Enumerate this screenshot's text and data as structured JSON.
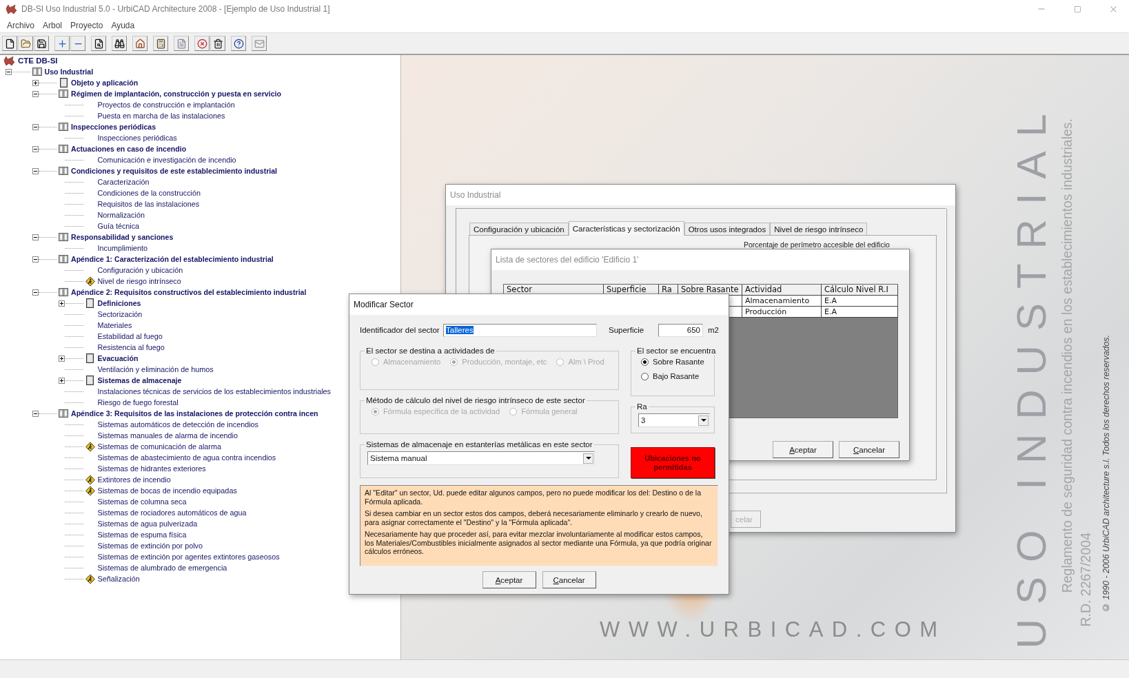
{
  "window": {
    "title": "DB-SI Uso Industrial 5.0 - UrbiCAD Architecture 2008 - [Ejemplo de Uso Industrial 1]"
  },
  "menu": [
    "Archivo",
    "Arbol",
    "Proyecto",
    "Ayuda"
  ],
  "tree": {
    "label": "CTE DB-SI",
    "kind": "root",
    "children": [
      {
        "label": "Uso Industrial",
        "kind": "chapter",
        "expanded": true,
        "children": [
          {
            "label": "Objeto y aplicación",
            "kind": "section",
            "expanded": false
          },
          {
            "label": "Régimen de implantación, construcción y puesta en servicio",
            "kind": "chapter",
            "expanded": true,
            "children": [
              {
                "label": "Proyectos de construcción e implantación",
                "kind": "item"
              },
              {
                "label": "Puesta en marcha de las instalaciones",
                "kind": "item"
              }
            ]
          },
          {
            "label": "Inspecciones periódicas",
            "kind": "chapter",
            "expanded": true,
            "children": [
              {
                "label": "Inspecciones periódicas",
                "kind": "item"
              }
            ]
          },
          {
            "label": "Actuaciones en caso de incendio",
            "kind": "chapter",
            "expanded": true,
            "children": [
              {
                "label": "Comunicación e investigación de incendio",
                "kind": "item"
              }
            ]
          },
          {
            "label": "Condiciones y requisitos de este establecimiento industrial",
            "kind": "chapter",
            "expanded": true,
            "children": [
              {
                "label": "Caracterización",
                "kind": "item"
              },
              {
                "label": "Condiciones de la construcción",
                "kind": "item"
              },
              {
                "label": "Requisitos de las instalaciones",
                "kind": "item"
              },
              {
                "label": "Normalización",
                "kind": "item"
              },
              {
                "label": "Guía técnica",
                "kind": "item"
              }
            ]
          },
          {
            "label": "Responsabilidad y sanciones",
            "kind": "chapter",
            "expanded": true,
            "children": [
              {
                "label": "Incumplimiento",
                "kind": "item"
              }
            ]
          },
          {
            "label": "Apéndice 1: Caracterización del establecimiento industrial",
            "kind": "chapter",
            "expanded": true,
            "children": [
              {
                "label": "Configuración y ubicación",
                "kind": "item"
              },
              {
                "label": "Nivel de riesgo intrínseco",
                "kind": "flagged"
              }
            ]
          },
          {
            "label": "Apéndice 2: Requisitos constructivos del establecimiento industrial",
            "kind": "chapter",
            "expanded": true,
            "children": [
              {
                "label": "Definiciones",
                "kind": "section",
                "expanded": false
              },
              {
                "label": "Sectorización",
                "kind": "item"
              },
              {
                "label": "Materiales",
                "kind": "item"
              },
              {
                "label": "Estabilidad al fuego",
                "kind": "item"
              },
              {
                "label": "Resistencia al fuego",
                "kind": "item"
              },
              {
                "label": "Evacuación",
                "kind": "section",
                "expanded": false
              },
              {
                "label": "Ventilación y eliminación de humos",
                "kind": "item"
              },
              {
                "label": "Sistemas de almacenaje",
                "kind": "section",
                "expanded": false
              },
              {
                "label": "Instalaciones técnicas de servicios de los establecimientos industriales",
                "kind": "item"
              },
              {
                "label": "Riesgo de fuego forestal",
                "kind": "item"
              }
            ]
          },
          {
            "label": "Apéndice 3: Requisitos de las instalaciones de protección contra incen",
            "kind": "chapter",
            "expanded": true,
            "children": [
              {
                "label": "Sistemas automáticos de detección de incendios",
                "kind": "item"
              },
              {
                "label": "Sistemas manuales de alarma de incendio",
                "kind": "item"
              },
              {
                "label": "Sistemas de comunicación de alarma",
                "kind": "flagged"
              },
              {
                "label": "Sistemas de abastecimiento de agua contra incendios",
                "kind": "item"
              },
              {
                "label": "Sistemas de hidrantes exteriores",
                "kind": "item"
              },
              {
                "label": "Extintores de incendio",
                "kind": "flagged"
              },
              {
                "label": "Sistemas de bocas de incendio equipadas",
                "kind": "flagged"
              },
              {
                "label": "Sistemas de columna seca",
                "kind": "item"
              },
              {
                "label": "Sistemas de rociadores automáticos de agua",
                "kind": "item"
              },
              {
                "label": "Sistemas de agua pulverizada",
                "kind": "item"
              },
              {
                "label": "Sistemas de espuma física",
                "kind": "item"
              },
              {
                "label": "Sistemas de extinción por polvo",
                "kind": "item"
              },
              {
                "label": "Sistemas de extinción por agentes extintores gaseosos",
                "kind": "item"
              },
              {
                "label": "Sistemas de alumbrado de emergencia",
                "kind": "item"
              },
              {
                "label": "Señalización",
                "kind": "flagged"
              }
            ]
          }
        ]
      }
    ]
  },
  "splash": {
    "site": "WWW.URBICAD.COM",
    "heading": "USO INDUSTRIAL",
    "subtitle": "Reglamento de seguridad contra incendios en los establecimientos industriales.",
    "decree": "R.D. 2267/2004",
    "copyright": "© 1990 - 2006 UrbiCAD architecture s.l. Todos los derechos reservados."
  },
  "background_window": {
    "title": "Uso Industrial",
    "tabs": [
      {
        "label": "Configuración y ubicación",
        "selected": false
      },
      {
        "label": "Características y sectorización",
        "selected": true
      },
      {
        "label": "Otros usos integrados",
        "selected": false
      },
      {
        "label": "Nivel de riesgo intrínseco",
        "selected": false
      }
    ],
    "partial_label": "Porcentaje de perímetro accesible del edificio",
    "partial_button": "celar"
  },
  "sector_list_window": {
    "title": "Lista de sectores del edificio 'Edificio 1'",
    "columns": [
      "Sector",
      "Superficie",
      "Ra",
      "Sobre Rasante",
      "Actividad",
      "Cálculo Nivel R.I"
    ],
    "rows": [
      {
        "activity": "Almacenamiento",
        "calculation": "E.A"
      },
      {
        "activity": "Producción",
        "calculation": "E.A"
      }
    ],
    "buttons": [
      "Aceptar",
      "Cancelar"
    ]
  },
  "modify_sector_dialog": {
    "title": "Modificar Sector",
    "id_label": "Identificador del sector",
    "id_value": "Talleres",
    "id_highlighted": true,
    "area_label": "Superficie",
    "area_value": "650",
    "area_unit": "m2",
    "destination": {
      "title": "El sector se destina a actividades de",
      "disabled": true,
      "options": [
        {
          "label": "Almacenamiento",
          "selected": false
        },
        {
          "label": "Producción, montaje, etc",
          "selected": true
        },
        {
          "label": "Alm \\ Prod",
          "selected": false
        }
      ]
    },
    "location": {
      "title": "El sector se encuentra",
      "disabled": false,
      "options": [
        {
          "label": "Sobre Rasante",
          "selected": true
        },
        {
          "label": "Bajo Rasante",
          "selected": false
        }
      ]
    },
    "method": {
      "title": "Método de cálculo del nivel de riesgo intrínseco de este sector",
      "disabled": true,
      "options": [
        {
          "label": "Fórmula específica de la actividad",
          "selected": true
        },
        {
          "label": "Fórmula general",
          "selected": false
        }
      ]
    },
    "ra": {
      "title": "Ra",
      "value": "3"
    },
    "storage": {
      "title": "Sistemas de almacenaje en estanterías metálicas en este sector",
      "value": "Sistema manual"
    },
    "alert": "Ubicaciones no permitidas",
    "note": [
      "Al \"Editar\" un sector, Ud. puede editar algunos campos, pero no puede modificar los del: Destino o de la Fórmula aplicada.",
      "Si desea cambiar en un sector estos dos campos, deberá necesariamente eliminarlo y crearlo de nuevo, para asignar correctamente el \"Destino\" y la \"Fórmula aplicada\".",
      "Necesariamente hay que proceder así, para evitar mezclar involuntariamente al modificar estos campos, los Materiales/Combustibles inicialmente asignados al sector mediante una Fórmula, ya que podría originar cálculos erróneos."
    ],
    "buttons": [
      "Aceptar",
      "Cancelar"
    ]
  }
}
